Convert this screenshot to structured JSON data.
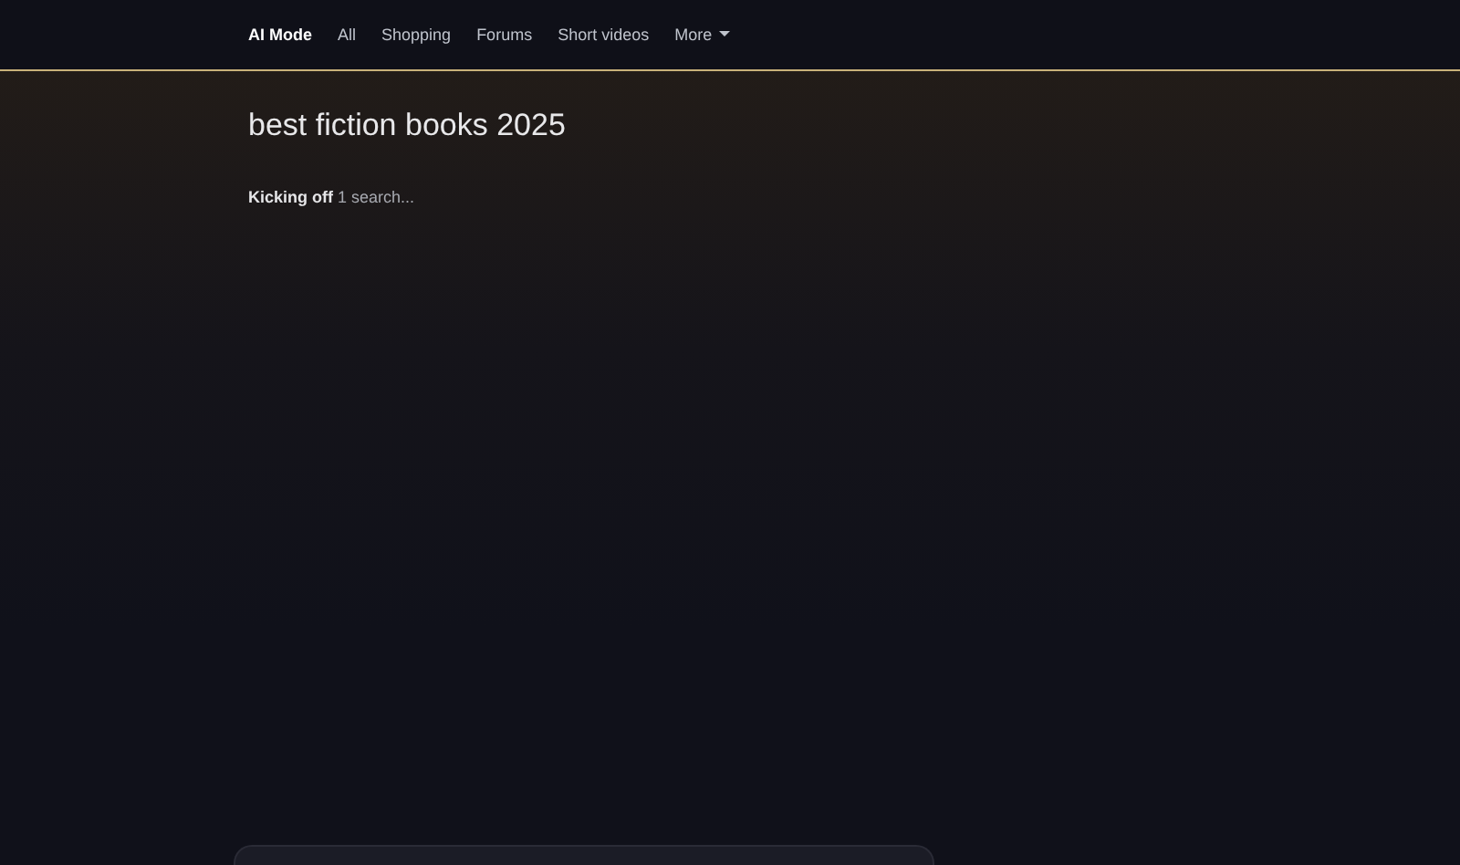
{
  "tabs": [
    {
      "label": "AI Mode",
      "selected": true
    },
    {
      "label": "All",
      "selected": false
    },
    {
      "label": "Shopping",
      "selected": false
    },
    {
      "label": "Forums",
      "selected": false
    },
    {
      "label": "Short videos",
      "selected": false
    }
  ],
  "more_menu": {
    "label": "More"
  },
  "query": "best fiction books 2025",
  "status": "**Kicking off** 1 search..."
}
